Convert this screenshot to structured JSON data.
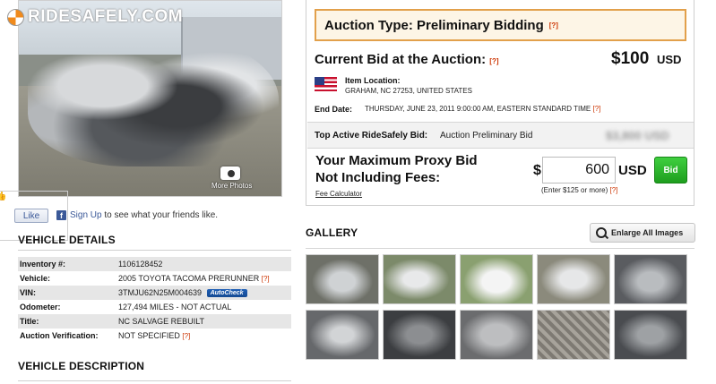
{
  "photo": {
    "logo_text": "RIDESAFELY.COM",
    "more_photos_label": "More Photos"
  },
  "social": {
    "like_label": "Like",
    "signup_link": "Sign Up",
    "signup_text": " to see what your friends like."
  },
  "vehicle_details": {
    "title": "VEHICLE DETAILS",
    "rows": [
      {
        "label": "Inventory #:",
        "value": "1106128452"
      },
      {
        "label": "Vehicle:",
        "value": "2005 TOYOTA TACOMA PRERUNNER"
      },
      {
        "label": "VIN:",
        "value": "3TMJU62N25M004639"
      },
      {
        "label": "Odometer:",
        "value": "127,494 MILES - NOT ACTUAL"
      },
      {
        "label": "Title:",
        "value": "NC SALVAGE REBUILT"
      },
      {
        "label": "Auction Verification:",
        "value": "NOT SPECIFIED"
      }
    ],
    "help": "[?]",
    "autocheck_label": "AutoCheck"
  },
  "vehicle_description": {
    "title": "VEHICLE DESCRIPTION"
  },
  "auction": {
    "type_label": "Auction Type: Preliminary Bidding",
    "help": "[?]",
    "current_bid_label": "Current Bid at the Auction:",
    "current_bid_amount": "$100",
    "current_bid_currency": "USD",
    "location_label": "Item Location:",
    "location_value": "GRAHAM, NC 27253, UNITED STATES",
    "end_date_label": "End Date:",
    "end_date_value": "THURSDAY, JUNE 23, 2011 9:00:00 AM, EASTERN STANDARD TIME",
    "top_bid_label": "Top Active RideSafely Bid:",
    "top_bid_value": "Auction Preliminary Bid",
    "top_bid_hidden": "$3,800 USD",
    "proxy_label": "Your Maximum Proxy Bid Not Including Fees:",
    "fee_calculator": "Fee Calculator",
    "dollar_sign": "$",
    "max_bid_value": "600",
    "max_bid_currency": "USD",
    "bid_button": "Bid",
    "bid_hint": "(Enter $125 or more)"
  },
  "gallery": {
    "title": "GALLERY",
    "enlarge_button": "Enlarge All Images",
    "thumbnail_count": 10
  }
}
